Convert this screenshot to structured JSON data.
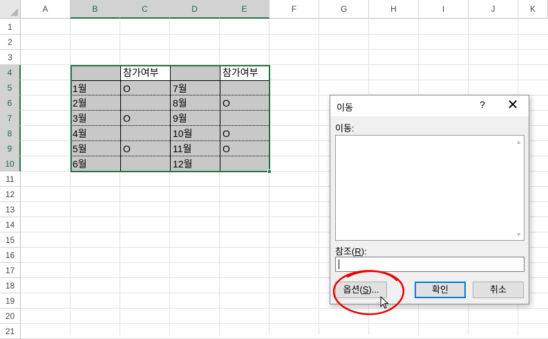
{
  "columns": [
    "A",
    "B",
    "C",
    "D",
    "E",
    "F",
    "G",
    "H",
    "I",
    "J",
    "K"
  ],
  "rows": [
    "1",
    "2",
    "3",
    "4",
    "5",
    "6",
    "7",
    "8",
    "9",
    "10",
    "11",
    "12",
    "13",
    "14",
    "15",
    "16",
    "17",
    "18",
    "19",
    "20",
    "21"
  ],
  "table": {
    "header": [
      "",
      "참가여부",
      "",
      "참가여부"
    ],
    "rows": [
      [
        "1월",
        "O",
        "7월",
        ""
      ],
      [
        "2월",
        "",
        "8월",
        "O"
      ],
      [
        "3월",
        "O",
        "9월",
        ""
      ],
      [
        "4월",
        "",
        "10월",
        "O"
      ],
      [
        "5월",
        "O",
        "11월",
        "O"
      ],
      [
        "6월",
        "",
        "12월",
        ""
      ]
    ]
  },
  "dialog": {
    "title": "이동",
    "help": "?",
    "close": "✕",
    "goto_label": "이동:",
    "ref_label_prefix": "참조(",
    "ref_label_key": "R",
    "ref_label_suffix": "):",
    "ref_value": "",
    "options_prefix": "옵션(",
    "options_key": "S",
    "options_suffix": ")...",
    "ok": "확인",
    "cancel": "취소"
  },
  "colors": {
    "selection": "#217346",
    "table_fill": "#c8c8c8",
    "annotation": "#e60000",
    "default_button_border": "#0078d7"
  }
}
